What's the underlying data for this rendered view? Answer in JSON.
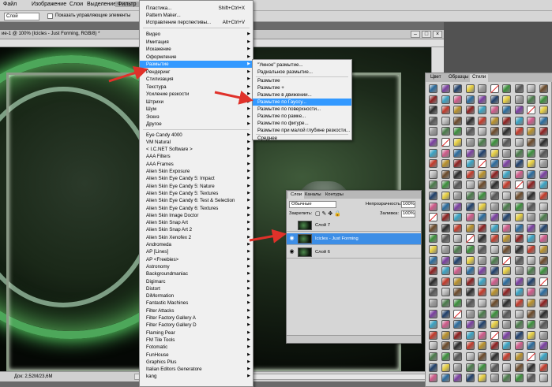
{
  "menubar": {
    "items": [
      "Файл",
      "Изображение",
      "Слои",
      "Выделение",
      "Фильтр"
    ]
  },
  "options": {
    "layer_select": "Слой",
    "show_controls_label": "Показать управляющие элементы"
  },
  "document": {
    "tab_title": "ие-1 @ 100% (Icicles - Just Forming, RGB/8) *",
    "status": "Док: 2,52М/23,6М"
  },
  "filter_menu": {
    "top_items": [
      {
        "label": "Пластика...",
        "shortcut": "Shift+Ctrl+X"
      },
      {
        "label": "Pattern Maker...",
        "shortcut": ""
      },
      {
        "label": "Исправление перспективы...",
        "shortcut": "Alt+Ctrl+V"
      }
    ],
    "categories": [
      "Видео",
      "Имитация",
      "Искажение",
      "Оформление",
      "Размытие",
      "Рендеринг",
      "Стилизация",
      "Текстура",
      "Усиление резкости",
      "Штрихи",
      "Шум",
      "Эскиз",
      "Другое"
    ],
    "highlighted": "Размытие",
    "plugins": [
      "Eye Candy 4000",
      "VM Natural",
      "< I.C.NET Software >",
      "AAA Filters",
      "AAA Frames",
      "Alien Skin Exposure",
      "Alien Skin Eye Candy 5: Impact",
      "Alien Skin Eye Candy 5: Nature",
      "Alien Skin Eye Candy 5: Textures",
      "Alien Skin Eye Candy 6: Test & Selection",
      "Alien Skin Eye Candy 6: Textures",
      "Alien Skin Image Doctor",
      "Alien Skin Snap Art",
      "Alien Skin Snap Art 2",
      "Alien Skin Xenofex 2",
      "Andromeda",
      "AP [Lines]",
      "AP <Freebies>",
      "Astronomy",
      "Backgroundmaniac",
      "Digimarc",
      "Distort",
      "DiMormation",
      "Fantastic Machines",
      "Filter Attacks",
      "Filter Factory Gallery A",
      "Filter Factory Gallery D",
      "Flaming Pear",
      "FM Tile Tools",
      "Fotomatic",
      "FunHouse",
      "Graphics Plus",
      "Italian Editors Generatore",
      "kang"
    ]
  },
  "blur_submenu": {
    "items": [
      "\"Умное\" размытие...",
      "Радиальное размытие...",
      "Размытие",
      "Размытие +",
      "Размытие в движении...",
      "Размытие по Гауссу...",
      "Размытие по поверхности...",
      "Размытие по рамке...",
      "Размытие по фигуре...",
      "Размытие при малой глубине резкости...",
      "Среднее"
    ],
    "highlighted": "Размытие по Гауссу..."
  },
  "layers_panel": {
    "tabs": [
      "Слои",
      "Каналы",
      "Контуры"
    ],
    "blend_mode": "Обычные",
    "opacity_label": "Непрозрачность:",
    "opacity_value": "100%",
    "lock_label": "Закрепить:",
    "fill_label": "Заливка:",
    "fill_value": "100%",
    "layers": [
      {
        "name": "Слой 7",
        "visible": false,
        "selected": false
      },
      {
        "name": "Icicles - Just Forming",
        "visible": true,
        "selected": true
      },
      {
        "name": "Слой 6",
        "visible": true,
        "selected": false
      }
    ]
  },
  "styles_panel": {
    "tabs": [
      "Цвет",
      "Образцы",
      "Стили"
    ],
    "active_tab": "Стили"
  },
  "colors": {
    "highlight": "#3399ff",
    "arrow": "#e0312a"
  }
}
